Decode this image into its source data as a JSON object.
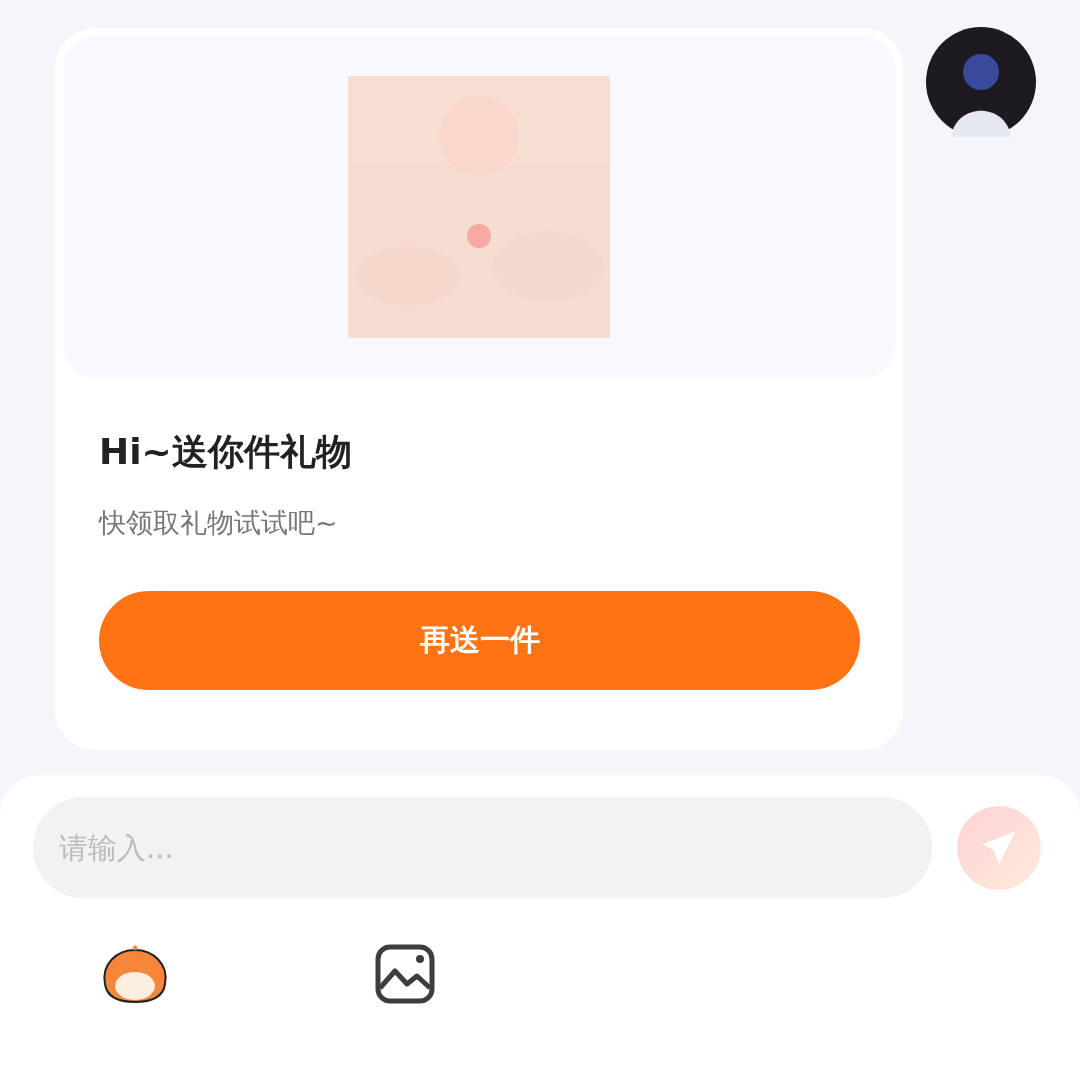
{
  "message": {
    "title": "Hi~送你件礼物",
    "subtitle": "快领取礼物试试吧~",
    "button": "再送一件"
  },
  "composer": {
    "placeholder": "请输入..."
  }
}
